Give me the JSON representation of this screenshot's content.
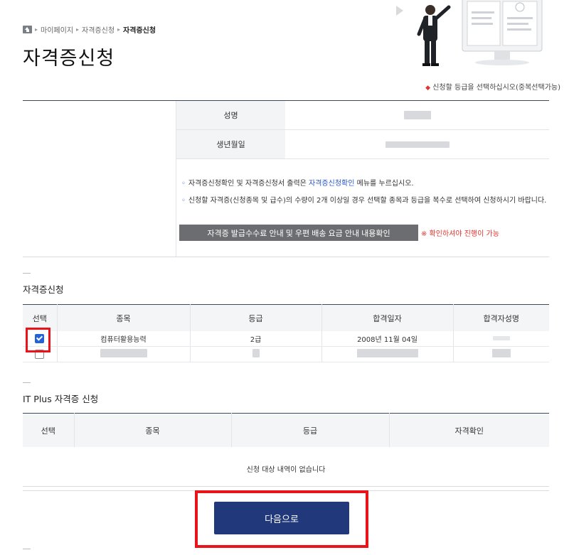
{
  "breadcrumb": {
    "home": "home",
    "items": [
      "마이페이지",
      "자격증신청",
      "자격증신청"
    ]
  },
  "page_title": "자격증신청",
  "note": "신청할 등급을 선택하십시오(중복선택가능)",
  "profile": {
    "name_label": "성명",
    "birth_label": "생년월일"
  },
  "notices": {
    "line1_pre": "자격증신청확인 및 자격증신청서 출력은 ",
    "line1_link": "자격증신청확인",
    "line1_post": " 메뉴를 누르십시오.",
    "line2": "신청할 자격증(신청종목 및 급수)의 수량이 2개 이상일 경우 선택할 종목과 등급을 복수로 선택하여 신청하시기 바랍니다."
  },
  "guide_button": "자격증 발급수수료 안내 및 우편 배송 요금 안내 내용확인",
  "guide_warning": "※ 확인하셔야 진행이 가능",
  "cert_section": {
    "title": "자격증신청",
    "headers": [
      "선택",
      "종목",
      "등급",
      "합격일자",
      "합격자성명"
    ],
    "rows": [
      {
        "checked": true,
        "item": "컴퓨터활용능력",
        "grade": "2급",
        "date": "2008년 11월 04일",
        "name": ""
      },
      {
        "checked": false,
        "item": "",
        "grade": "",
        "date": "",
        "name": ""
      }
    ]
  },
  "itplus_section": {
    "title": "IT Plus 자격증 신청",
    "headers": [
      "선택",
      "종목",
      "등급",
      "자격확인"
    ],
    "empty_message": "신청 대상 내역이 없습니다"
  },
  "next_button": "다음으로",
  "colors": {
    "accent": "#21397a",
    "highlight": "#e8141a",
    "checkbox": "#2463d6"
  }
}
